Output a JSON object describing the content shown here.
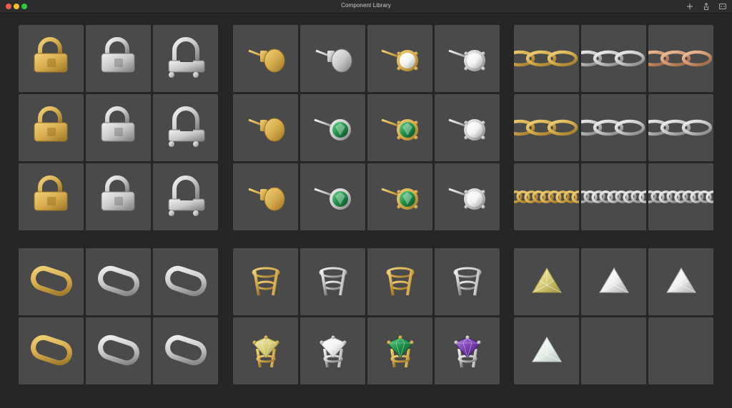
{
  "window": {
    "title": "Component Library"
  },
  "colors": {
    "gold": "#d7ad4d",
    "gold_dark": "#9a7426",
    "silver": "#c9c9c9",
    "silver_dark": "#7c7c7c",
    "emerald": "#1f8e4a",
    "amethyst": "#7a3fb0",
    "diamond": "#f2f2f2",
    "citrine": "#d9cf7a",
    "opal": "#e9efe9",
    "tile_bg": "#4a4a4a",
    "window_bg": "#262626"
  },
  "groups": {
    "clasps": [
      [
        {
          "item": "lock-clasp",
          "metal": "gold"
        },
        {
          "item": "lock-clasp",
          "metal": "silver"
        },
        {
          "item": "open-clasp",
          "metal": "silver"
        }
      ],
      [
        {
          "item": "lock-clasp",
          "metal": "gold"
        },
        {
          "item": "lock-clasp",
          "metal": "silver"
        },
        {
          "item": "open-clasp",
          "metal": "silver"
        }
      ],
      [
        {
          "item": "lock-clasp",
          "metal": "gold"
        },
        {
          "item": "lock-clasp",
          "metal": "silver"
        },
        {
          "item": "open-clasp",
          "metal": "silver"
        }
      ]
    ],
    "studs": [
      [
        {
          "item": "disc-stud",
          "metal": "gold"
        },
        {
          "item": "disc-stud",
          "metal": "silver"
        },
        {
          "item": "gem-stud",
          "metal": "gold",
          "gem": "diamond"
        },
        {
          "item": "gem-stud",
          "metal": "silver",
          "gem": "diamond"
        }
      ],
      [
        {
          "item": "disc-stud",
          "metal": "gold"
        },
        {
          "item": "bezel-stud",
          "metal": "silver",
          "gem": "emerald"
        },
        {
          "item": "gem-stud",
          "metal": "gold",
          "gem": "emerald"
        },
        {
          "item": "gem-stud",
          "metal": "silver",
          "gem": "diamond"
        }
      ],
      [
        {
          "item": "disc-stud",
          "metal": "gold"
        },
        {
          "item": "bezel-stud",
          "metal": "silver",
          "gem": "emerald"
        },
        {
          "item": "gem-stud",
          "metal": "gold",
          "gem": "emerald"
        },
        {
          "item": "gem-stud",
          "metal": "silver",
          "gem": "diamond"
        }
      ]
    ],
    "chains": [
      [
        {
          "item": "cable-chain",
          "metal": "gold"
        },
        {
          "item": "cable-chain",
          "metal": "silver"
        },
        {
          "item": "cable-chain",
          "metal": "rose"
        }
      ],
      [
        {
          "item": "cable-chain",
          "metal": "gold"
        },
        {
          "item": "cable-chain",
          "metal": "silver"
        },
        {
          "item": "cable-chain",
          "metal": "silver"
        }
      ],
      [
        {
          "item": "curb-chain",
          "metal": "gold"
        },
        {
          "item": "curb-chain",
          "metal": "silver"
        },
        {
          "item": "curb-chain",
          "metal": "silver"
        }
      ]
    ],
    "rings": [
      [
        {
          "item": "oval-jump-ring",
          "metal": "gold"
        },
        {
          "item": "oval-jump-ring",
          "metal": "silver"
        },
        {
          "item": "oval-jump-ring",
          "metal": "silver"
        }
      ],
      [
        {
          "item": "oval-jump-ring",
          "metal": "gold"
        },
        {
          "item": "oval-jump-ring",
          "metal": "silver"
        },
        {
          "item": "oval-jump-ring",
          "metal": "silver"
        }
      ]
    ],
    "settings": [
      [
        {
          "item": "prong-setting",
          "metal": "gold"
        },
        {
          "item": "prong-setting",
          "metal": "silver"
        },
        {
          "item": "prong-setting",
          "metal": "gold"
        },
        {
          "item": "prong-setting",
          "metal": "silver"
        }
      ],
      [
        {
          "item": "set-gem",
          "metal": "gold",
          "gem": "citrine"
        },
        {
          "item": "set-gem",
          "metal": "silver",
          "gem": "diamond"
        },
        {
          "item": "set-gem",
          "metal": "gold",
          "gem": "emerald"
        },
        {
          "item": "set-gem",
          "metal": "silver",
          "gem": "amethyst"
        }
      ]
    ],
    "gems": [
      [
        {
          "item": "trillion-gem",
          "gem": "citrine"
        },
        {
          "item": "trillion-gem",
          "gem": "diamond"
        },
        {
          "item": "trillion-gem",
          "gem": "diamond"
        }
      ],
      [
        {
          "item": "trillion-gem",
          "gem": "opal"
        },
        {
          "item": "empty"
        },
        {
          "item": "empty"
        }
      ]
    ]
  }
}
